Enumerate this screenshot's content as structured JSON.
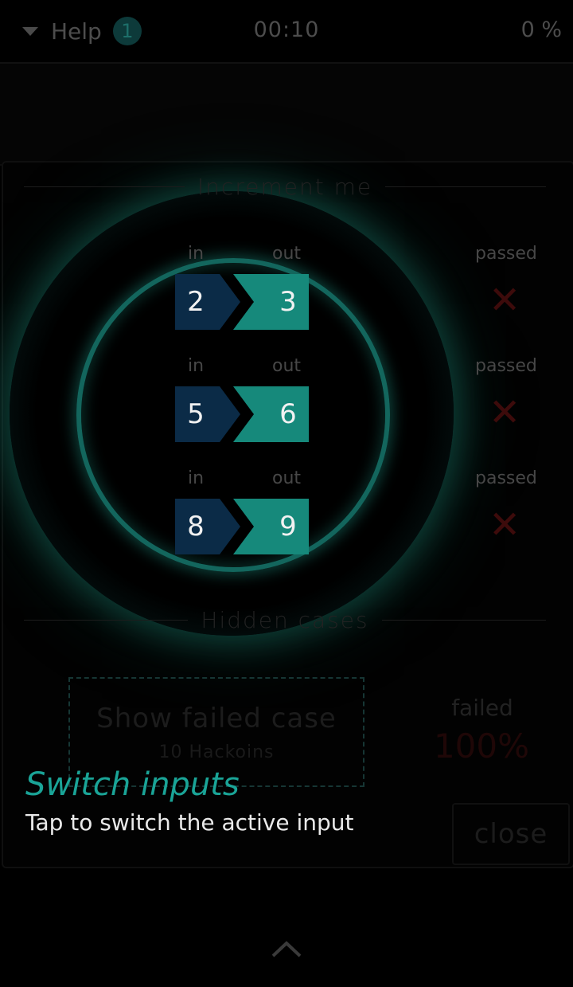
{
  "header": {
    "help_label": "Help",
    "help_badge": "1",
    "timer": "00:10",
    "progress": "0 %"
  },
  "puzzle": {
    "title": "Increment me",
    "cases": [
      {
        "in_label": "in",
        "out_label": "out",
        "input": "2",
        "output": "3",
        "passed_label": "passed",
        "passed_mark": "✕"
      },
      {
        "in_label": "in",
        "out_label": "out",
        "input": "5",
        "output": "6",
        "passed_label": "passed",
        "passed_mark": "✕"
      },
      {
        "in_label": "in",
        "out_label": "out",
        "input": "8",
        "output": "9",
        "passed_label": "passed",
        "passed_mark": "✕"
      }
    ]
  },
  "hidden": {
    "title": "Hidden cases",
    "show_failed_label": "Show failed case",
    "show_failed_cost": "10 Hackoins",
    "failed_label": "failed",
    "failed_percent": "100%"
  },
  "tip": {
    "title": "Switch inputs",
    "body": "Tap to switch the active input",
    "close_label": "close"
  },
  "icons": {
    "dropdown": "caret-down-icon",
    "fail": "cross-icon",
    "expand": "chevron-up-icon"
  },
  "colors": {
    "accent": "#1aa497",
    "input_box": "#0b2b47",
    "output_box": "#16897b",
    "fail": "#3d0b0b"
  }
}
